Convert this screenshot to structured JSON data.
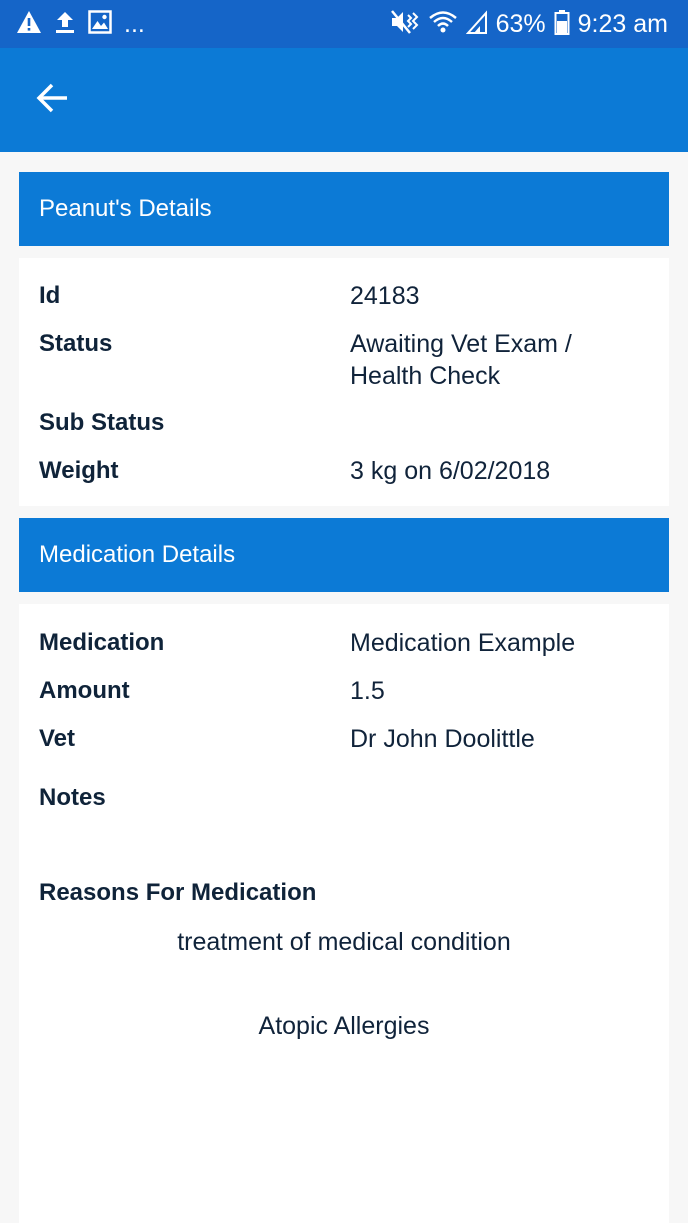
{
  "statusbar": {
    "overflow_label": "...",
    "battery_percent": "63%",
    "time": "9:23 am",
    "icons": [
      "warning-icon",
      "upload-icon",
      "image-icon",
      "mute-vibrate-icon",
      "wifi-icon",
      "signal-icon",
      "battery-icon"
    ]
  },
  "appbar": {
    "back_icon": "arrow-back-icon"
  },
  "details": {
    "header": "Peanut's Details",
    "fields": [
      {
        "label": "Id",
        "value": "24183"
      },
      {
        "label": "Status",
        "value": "Awaiting Vet Exam / Health Check"
      },
      {
        "label": "Sub Status",
        "value": ""
      },
      {
        "label": "Weight",
        "value": "3 kg on 6/02/2018"
      }
    ]
  },
  "medication": {
    "header": "Medication Details",
    "fields": [
      {
        "label": "Medication",
        "value": "Medication Example"
      },
      {
        "label": "Amount",
        "value": "1.5"
      },
      {
        "label": "Vet",
        "value": "Dr John Doolittle"
      },
      {
        "label": "Notes",
        "value": ""
      }
    ],
    "reasons_label": "Reasons For Medication",
    "reasons": [
      "treatment of medical condition",
      "Atopic Allergies"
    ]
  },
  "colors": {
    "statusbar": "#1565c8",
    "primary": "#0c7ad6",
    "background": "#f7f7f7",
    "text": "#10233a"
  }
}
